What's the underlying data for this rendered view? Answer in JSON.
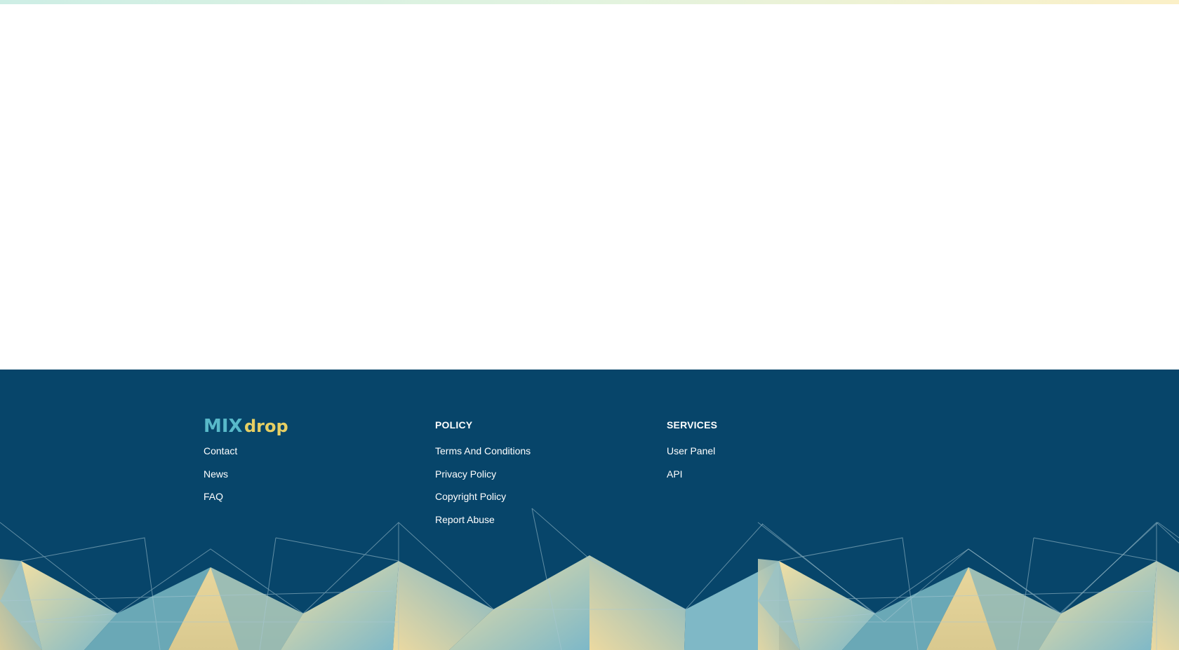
{
  "colors": {
    "footer_bg": "#07456a",
    "accent_teal": "#58b9c9",
    "accent_yellow": "#f2d35a",
    "link_text": "#ffffff"
  },
  "footer": {
    "brand": {
      "logo_part1": "MIX",
      "logo_part2": "drop",
      "links": [
        "Contact",
        "News",
        "FAQ"
      ]
    },
    "policy": {
      "heading": "POLICY",
      "links": [
        "Terms And Conditions",
        "Privacy Policy",
        "Copyright Policy",
        "Report Abuse"
      ]
    },
    "services": {
      "heading": "SERVICES",
      "links": [
        "User Panel",
        "API"
      ]
    }
  }
}
